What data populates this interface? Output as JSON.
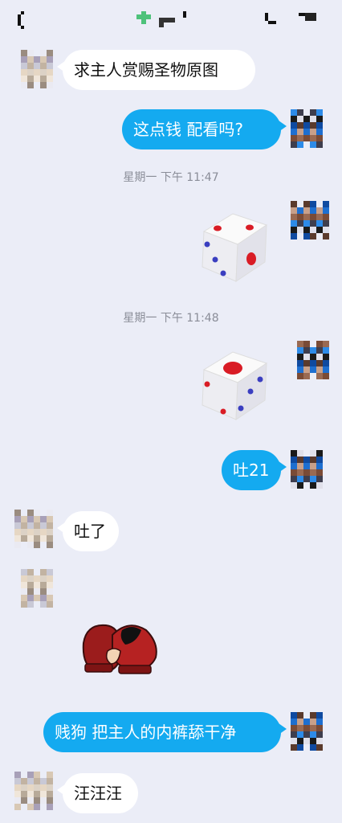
{
  "timestamps": [
    "星期一 下午 11:47",
    "星期一 下午 11:48"
  ],
  "messages": [
    {
      "side": "in",
      "type": "text",
      "text": "求主人赏赐圣物原图"
    },
    {
      "side": "out",
      "type": "text",
      "text": "这点钱 配看吗?"
    },
    {
      "side": "out",
      "type": "dice",
      "value": "3"
    },
    {
      "side": "out",
      "type": "dice",
      "value": "5"
    },
    {
      "side": "out",
      "type": "text",
      "text": "吐21"
    },
    {
      "side": "in",
      "type": "text",
      "text": "吐了"
    },
    {
      "side": "in",
      "type": "sticker",
      "icon": "boxing-gloves-sticker"
    },
    {
      "side": "out",
      "type": "text",
      "text": "贱狗 把主人的内裤舔干净"
    },
    {
      "side": "in",
      "type": "text",
      "text": "汪汪汪"
    }
  ],
  "colors": {
    "outgoing_bubble": "#14aaf0",
    "incoming_bubble": "#ffffff",
    "background": "#ebedf7"
  }
}
